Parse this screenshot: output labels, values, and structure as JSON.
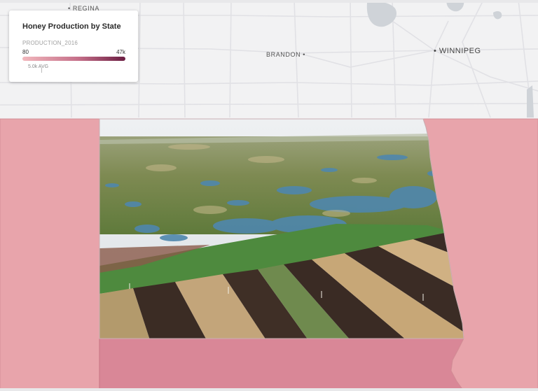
{
  "legend": {
    "title": "Honey Production by State",
    "field": "PRODUCTION_2016",
    "min_label": "80",
    "max_label": "47k",
    "avg_label": "5.0k AVG",
    "color_low": "#f2b8bd",
    "color_high": "#6b1d42"
  },
  "cities": {
    "regina": "• REGINA",
    "brandon": "BRANDON •",
    "winnipeg": "• WINNIPEG"
  },
  "states": [
    {
      "id": "montana",
      "color": "#e8a4ab"
    },
    {
      "id": "north-dakota",
      "photo": "aerial prairie pothole wetlands and striped crop fields"
    },
    {
      "id": "south-dakota",
      "color": "#d98797"
    },
    {
      "id": "minnesota",
      "color": "#e8a4ab"
    }
  ],
  "colors": {
    "basemap": "#f2f2f3",
    "roads": "#e3e3e6"
  }
}
